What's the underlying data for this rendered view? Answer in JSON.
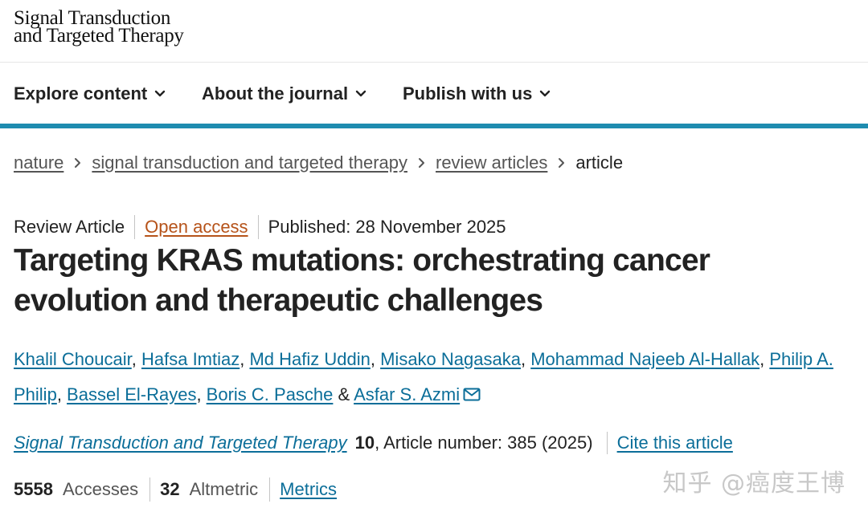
{
  "header": {
    "logo_line1": "Signal Transduction",
    "logo_line2": "and Targeted Therapy"
  },
  "nav": {
    "items": [
      {
        "label": "Explore content"
      },
      {
        "label": "About the journal"
      },
      {
        "label": "Publish with us"
      }
    ],
    "accent_color": "#1e8cb0"
  },
  "breadcrumb": {
    "items": [
      "nature",
      "signal transduction and targeted therapy",
      "review articles"
    ],
    "current": "article"
  },
  "article": {
    "type": "Review Article",
    "access": "Open access",
    "published": "Published: 28 November 2025",
    "title": "Targeting KRAS mutations: orchestrating cancer evolution and therapeutic challenges",
    "authors": [
      "Khalil Choucair",
      "Hafsa Imtiaz",
      "Md Hafiz Uddin",
      "Misako Nagasaka",
      "Mohammad Najeeb Al-Hallak",
      "Philip A. Philip",
      "Bassel El-Rayes",
      "Boris C. Pasche",
      "Asfar S. Azmi"
    ],
    "author_separator": ", ",
    "author_last_separator": " & ",
    "journal": "Signal Transduction and Targeted Therapy",
    "volume": "10",
    "article_number_text": ", Article number: 385 (2025)",
    "cite_label": "Cite this article",
    "link_color": "#0b6e99"
  },
  "metrics": {
    "accesses_value": "5558",
    "accesses_label": "Accesses",
    "altmetric_value": "32",
    "altmetric_label": "Altmetric",
    "link_label": "Metrics"
  },
  "watermark": "知乎 @癌度王博"
}
